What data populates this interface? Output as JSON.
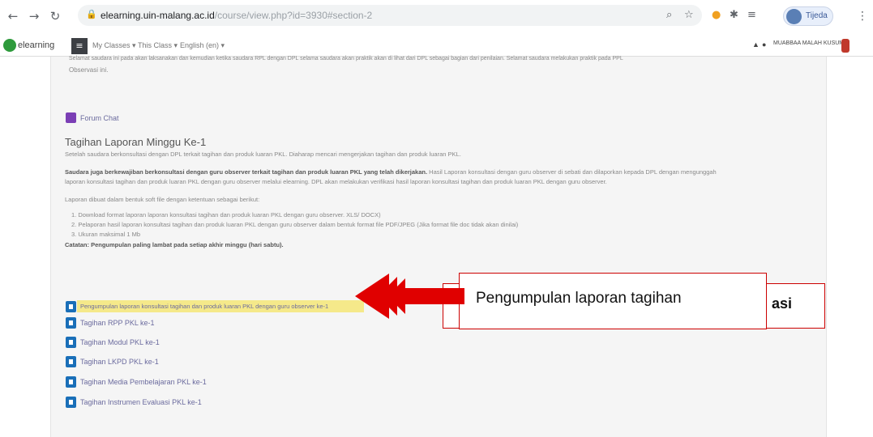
{
  "browser": {
    "url_domain": "elearning.uin-malang.ac.id",
    "url_path": "/course/view.php?id=3930#section-2",
    "profile_label": "Tijeda"
  },
  "navbar": {
    "brand": "elearning",
    "links": [
      "My Classes ▾",
      "This Class ▾",
      "English (en) ▾"
    ],
    "user": "MUABBAA MALAH KUSUMA"
  },
  "intro": {
    "line1": "Selamat saudara ini pada akan laksanakan dan kemudian ketika saudara RPL dengan DPL selama saudara akan praktik akan di lihat dari DPL sebagai bagian dari penilaian. Selamat saudara melakukan praktik pada PPL",
    "line2": "Observasi ini."
  },
  "forum": {
    "label": "Forum Chat"
  },
  "section": {
    "title": "Tagihan Laporan Minggu Ke-1",
    "desc": "Setelah saudara berkonsultasi dengan DPL terkait tagihan dan produk luaran PKL. Diaharap mencari mengerjakan tagihan dan produk luaran PKL.",
    "bold_lead": "Saudara juga berkewajiban berkonsultasi dengan guru observer terkait tagihan dan produk luaran PKL yang telah dikerjakan.",
    "para_rest": " Hasil Laporan konsultasi dengan guru observer di sebati dan dilaporkan kepada DPL dengan mengunggah",
    "para_line2": "laporan konsultasi tagihan dan produk luaran PKL dengan guru observer melalui elearning. DPL akan melakukan verifikasi hasil laporan konsultasi tagihan dan produk luaran PKL dengan guru observer.",
    "format_intro": "Laporan dibuat dalam bentuk soft file dengan ketentuan sebagai berikut:",
    "items": [
      "1. Download format laporan laporan konsultasi tagihan dan produk luaran PKL dengan guru observer. XLS/ DOCX)",
      "2. Pelaporan hasil laporan konsultasi tagihan dan produk luaran PKL dengan guru observer dalam bentuk format file PDF/JPEG (Jika format file doc tidak akan dinilai)",
      "3. Ukuran maksimal 1 Mb"
    ],
    "note": "Catatan: Pengumpulan paling lambat pada setiap akhir minggu (hari sabtu)."
  },
  "activities": [
    "Pengumpulan laporan konsultasi tagihan dan produk luaran PKL dengan guru observer ke-1",
    "Tagihan RPP PKL ke-1",
    "Tagihan Modul PKL ke-1",
    "Tagihan LKPD PKL ke-1",
    "Tagihan Media Pembelajaran PKL ke-1",
    "Tagihan Instrumen Evaluasi PKL ke-1"
  ],
  "annotation": {
    "label": "Pengumpulan laporan tagihan",
    "behind_label": "asi",
    "color": "#e00000"
  }
}
